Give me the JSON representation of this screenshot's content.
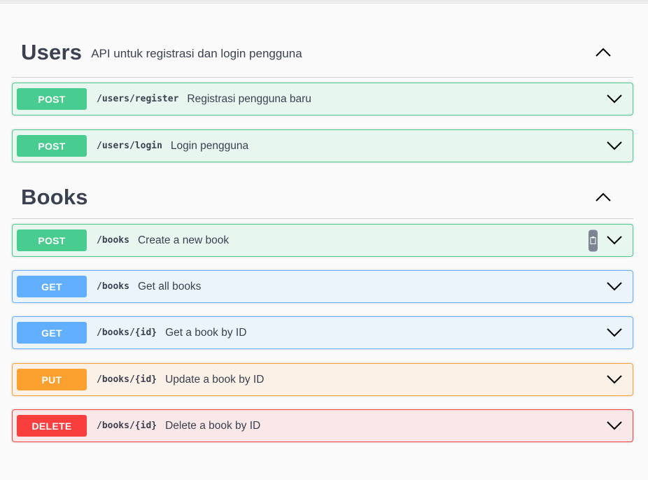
{
  "sections": {
    "users": {
      "title": "Users",
      "description": "API untuk registrasi dan login pengguna",
      "toggle_icon": "chevron-up-icon",
      "operations": [
        {
          "method": "POST",
          "path": "/users/register",
          "summary": "Registrasi pengguna baru"
        },
        {
          "method": "POST",
          "path": "/users/login",
          "summary": "Login pengguna"
        }
      ]
    },
    "books": {
      "title": "Books",
      "description": "",
      "toggle_icon": "chevron-up-icon",
      "operations": [
        {
          "method": "POST",
          "path": "/books",
          "summary": "Create a new book",
          "extra_icon": "copy-icon"
        },
        {
          "method": "GET",
          "path": "/books",
          "summary": "Get all books"
        },
        {
          "method": "GET",
          "path": "/books/{id}",
          "summary": "Get a book by ID"
        },
        {
          "method": "PUT",
          "path": "/books/{id}",
          "summary": "Update a book by ID"
        },
        {
          "method": "DELETE",
          "path": "/books/{id}",
          "summary": "Delete a book by ID"
        }
      ]
    }
  },
  "colors": {
    "post": "#49cc90",
    "get": "#61affe",
    "put": "#fca130",
    "delete": "#f93e3e",
    "text": "#3b4151"
  }
}
